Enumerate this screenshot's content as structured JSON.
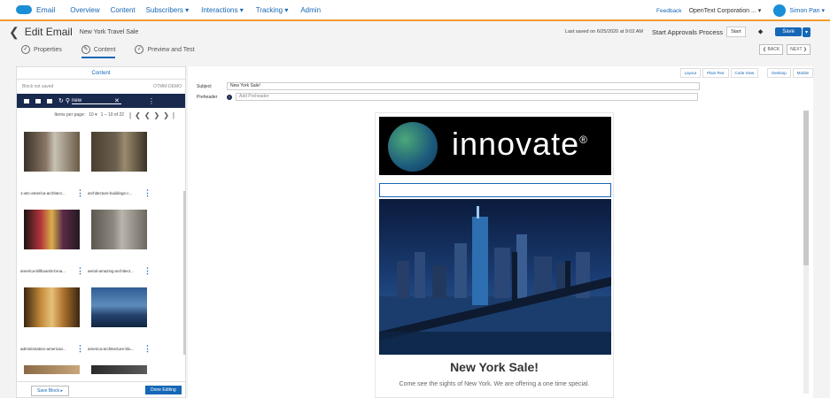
{
  "topnav": {
    "app": "Email",
    "items": [
      "Overview",
      "Content",
      "Subscribers ▾",
      "Interactions ▾",
      "Tracking ▾",
      "Admin"
    ],
    "feedback": "Feedback",
    "org": "OpenText Corporation ... ▾",
    "user": "Simon Pan ▾"
  },
  "header": {
    "back": "❮",
    "title": "Edit Email",
    "email_name": "New York Travel Sale",
    "saved": "Last saved on 6/25/2020 at 9:02 AM",
    "approvals": "Start Approvals Process",
    "start": "Start",
    "save": "Save",
    "save_dd": "▾"
  },
  "tabs": [
    {
      "label": "Properties",
      "icon": "✓"
    },
    {
      "label": "Content",
      "icon": "✎"
    },
    {
      "label": "Preview and Test",
      "icon": "✓"
    }
  ],
  "nav_buttons": {
    "back": "❮ BACK",
    "next": "NEXT ❯"
  },
  "view_buttons": [
    "Layout",
    "Plain Text",
    "Code View",
    "Desktop",
    "Mobile"
  ],
  "content_panel": {
    "header": "Content",
    "block_status": "Block not saved",
    "block_name": "OTMM-DEMO",
    "search_value": "new",
    "items_per_page_label": "Items per page:",
    "items_per_page": "10 ▾",
    "range": "1 – 10 of 22",
    "cards": [
      {
        "label": "1-wtc-america-architect..."
      },
      {
        "label": "architecture-buildings-c..."
      },
      {
        "label": "america-billboards-broa..."
      },
      {
        "label": "aerial-amazing-architect..."
      },
      {
        "label": "administration-american..."
      },
      {
        "label": "america-architecture-blu..."
      }
    ],
    "save_block": "Save Block ▸",
    "done_editing": "Done Editing"
  },
  "fields": {
    "subject_label": "Subject",
    "subject_value": "New York Sale!",
    "preheader_label": "Preheader",
    "preheader_placeholder": "Add Preheader"
  },
  "email": {
    "brand": "innovate",
    "reg": "®",
    "headline": "New York Sale!",
    "body": "Come see the sights of New York. We are offering a one time special."
  }
}
